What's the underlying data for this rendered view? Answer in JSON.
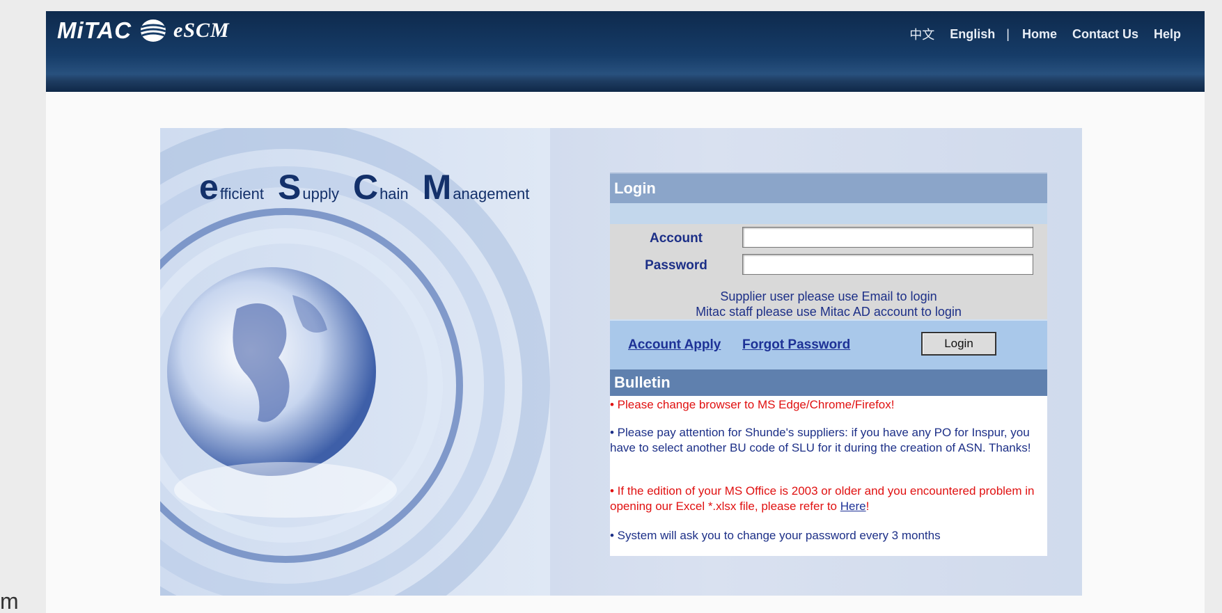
{
  "header": {
    "logo_brand": "MiTAC",
    "logo_product": "eSCM",
    "nav": {
      "chinese": "中文",
      "english": "English",
      "separator": "|",
      "home": "Home",
      "contact": "Contact Us",
      "help": "Help"
    }
  },
  "tagline": {
    "w1_initial": "e",
    "w1_rest": "fficient",
    "w2_initial": "S",
    "w2_rest": "upply",
    "w3_initial": "C",
    "w3_rest": "hain",
    "w4_initial": "M",
    "w4_rest": "anagement"
  },
  "login": {
    "title": "Login",
    "account_label": "Account",
    "account_value": "",
    "password_label": "Password",
    "password_value": "",
    "hint_supplier": "Supplier user please use Email to login",
    "hint_staff": "Mitac staff please use Mitac AD account to login",
    "account_apply": "Account Apply",
    "forgot_password": "Forgot Password",
    "login_button": "Login"
  },
  "bulletin": {
    "title": "Bulletin",
    "item1": "• Please change browser to MS Edge/Chrome/Firefox!",
    "item2": "• Please pay attention for Shunde's suppliers: if you have any PO for Inspur, you have to select another BU code of SLU for it during the creation of ASN. Thanks!",
    "item3_text": "• If the edition of your MS Office is 2003 or older and you encountered problem in opening our Excel *.xlsx file, please refer to ",
    "item3_link": "Here",
    "item3_end": "!",
    "item4": "• System will ask you to change your password every 3 months"
  },
  "corner_text": "m",
  "colors": {
    "header_navy": "#163c68",
    "link_blue": "#1d3196",
    "alert_red": "#e01010"
  }
}
